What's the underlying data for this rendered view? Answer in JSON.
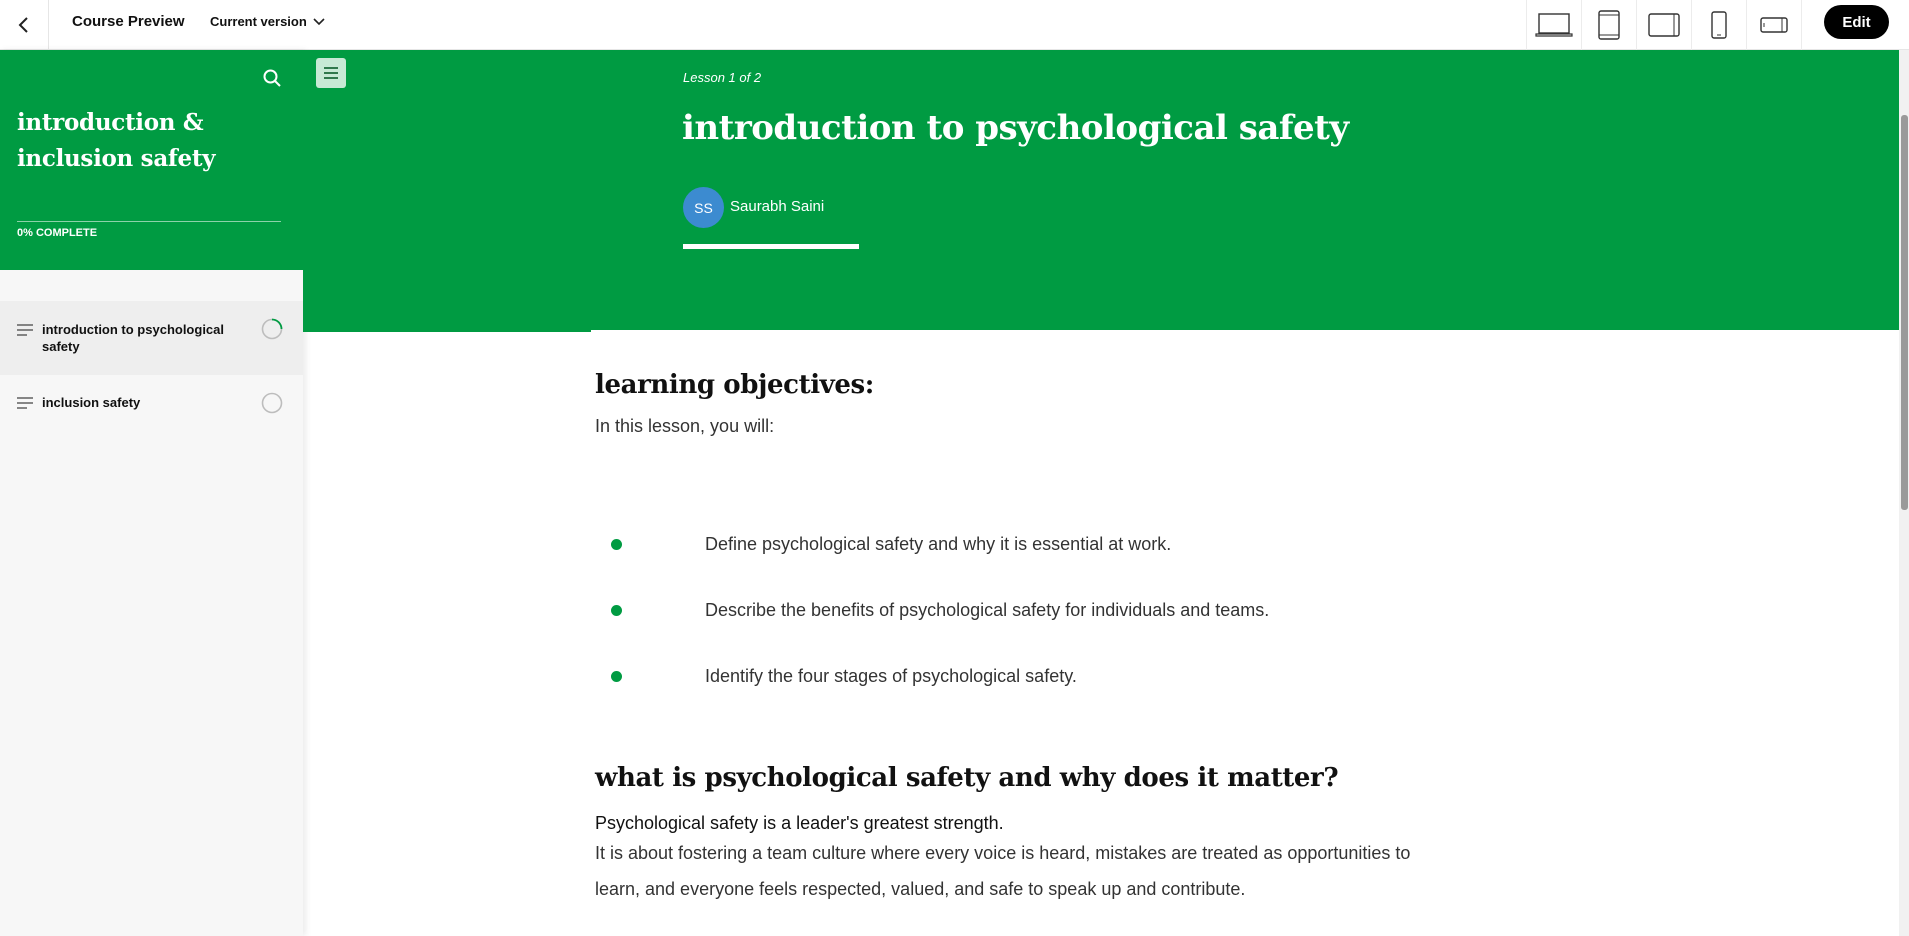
{
  "topbar": {
    "title": "Course Preview",
    "version_label": "Current version",
    "device_icons": [
      "laptop-icon",
      "tablet-portrait-icon",
      "tablet-landscape-icon",
      "phone-portrait-icon",
      "phone-landscape-icon"
    ],
    "edit_label": "Edit"
  },
  "sidebar": {
    "course_title": "introduction & inclusion safety",
    "progress_label": "0% COMPLETE",
    "progress_value": 0,
    "items": [
      {
        "label": "introduction to psychological safety",
        "status": "in-progress",
        "active": true
      },
      {
        "label": "inclusion safety",
        "status": "not-started",
        "active": false
      }
    ]
  },
  "lesson": {
    "count_label": "Lesson 1 of 2",
    "title": "introduction to psychological safety",
    "author_initials": "SS",
    "author_name": "Saurabh Saini"
  },
  "content": {
    "objectives_heading": "learning objectives:",
    "objectives_intro": "In this lesson, you will:",
    "objectives": [
      "Define psychological safety and why it is essential at work.",
      "Describe the benefits of psychological safety for individuals and teams.",
      "Identify the four stages of psychological safety."
    ],
    "section_heading": "what is psychological safety and why does it matter?",
    "section_lead": "Psychological safety is a leader's greatest strength.",
    "section_body_line1": "It is about fostering a team culture where every voice is heard, mistakes are treated as opportunities to",
    "section_body_line2": "learn, and everyone feels respected, valued, and safe to speak up and contribute."
  },
  "colors": {
    "brand_green": "#009b42",
    "avatar_blue": "#3c8bd0"
  }
}
